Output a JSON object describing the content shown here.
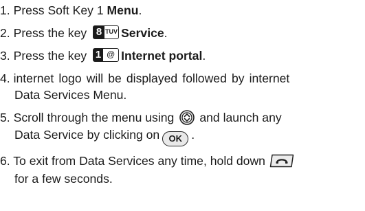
{
  "steps": [
    {
      "num": "1.",
      "pre": "Press Soft Key 1 ",
      "bold": "Menu",
      "post": "."
    },
    {
      "num": "2.",
      "pre": "Press the key ",
      "bold": "Service",
      "post": ".",
      "key": {
        "main": "8",
        "sub": "TUV"
      }
    },
    {
      "num": "3.",
      "pre": "Press the key ",
      "bold": "Internet portal",
      "post": ".",
      "key": {
        "main": "1",
        "sub": "@"
      }
    },
    {
      "num": "4.",
      "line1": "internet logo will be displayed followed by internet",
      "line2": "Data Services Menu."
    },
    {
      "num": "5.",
      "line1_pre": "Scroll through the menu using",
      "line1_post": "and launch any",
      "line2_pre": "Data Service by clicking on",
      "ok_label": "OK",
      "line2_post": "."
    },
    {
      "num": "6.",
      "line1": "To exit from Data Services any time, hold down",
      "line2": "for a few seconds."
    }
  ],
  "icons": {
    "key_8": "key-8-tuv-icon",
    "key_1": "key-1-at-icon",
    "nav": "navigation-up-down-icon",
    "ok": "ok-button-icon",
    "end": "end-call-key-icon"
  }
}
